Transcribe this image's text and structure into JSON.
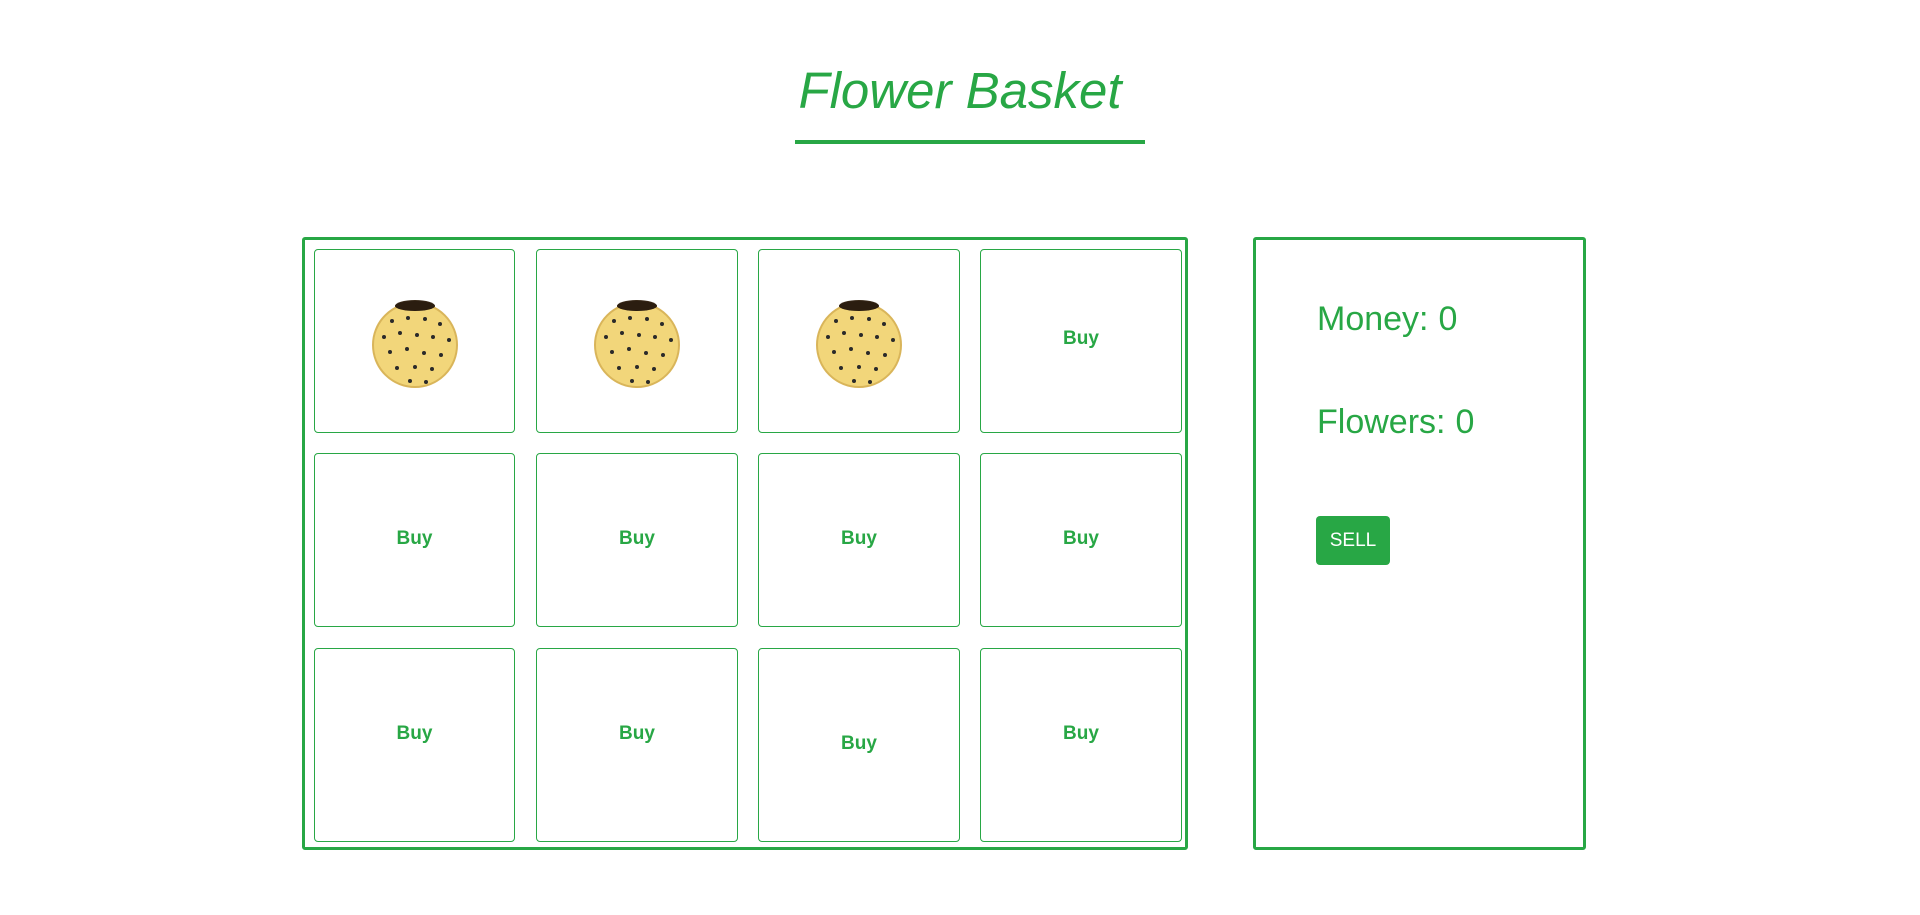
{
  "header": {
    "title": "Flower Basket"
  },
  "grid": {
    "cells": [
      {
        "kind": "pot",
        "label": ""
      },
      {
        "kind": "pot",
        "label": ""
      },
      {
        "kind": "pot",
        "label": ""
      },
      {
        "kind": "buy",
        "label": "Buy"
      },
      {
        "kind": "buy",
        "label": "Buy"
      },
      {
        "kind": "buy",
        "label": "Buy"
      },
      {
        "kind": "buy",
        "label": "Buy"
      },
      {
        "kind": "buy",
        "label": "Buy"
      },
      {
        "kind": "buy",
        "label": "Buy"
      },
      {
        "kind": "buy",
        "label": "Buy"
      },
      {
        "kind": "buy",
        "label": "Buy"
      },
      {
        "kind": "buy",
        "label": "Buy"
      }
    ]
  },
  "stats": {
    "money_label": "Money:",
    "money_value": "0",
    "flowers_label": "Flowers:",
    "flowers_value": "0"
  },
  "actions": {
    "sell_label": "SELL"
  },
  "colors": {
    "accent": "#28a745",
    "pot_body": "#f2d67a",
    "pot_dots": "#2a2a2a"
  }
}
